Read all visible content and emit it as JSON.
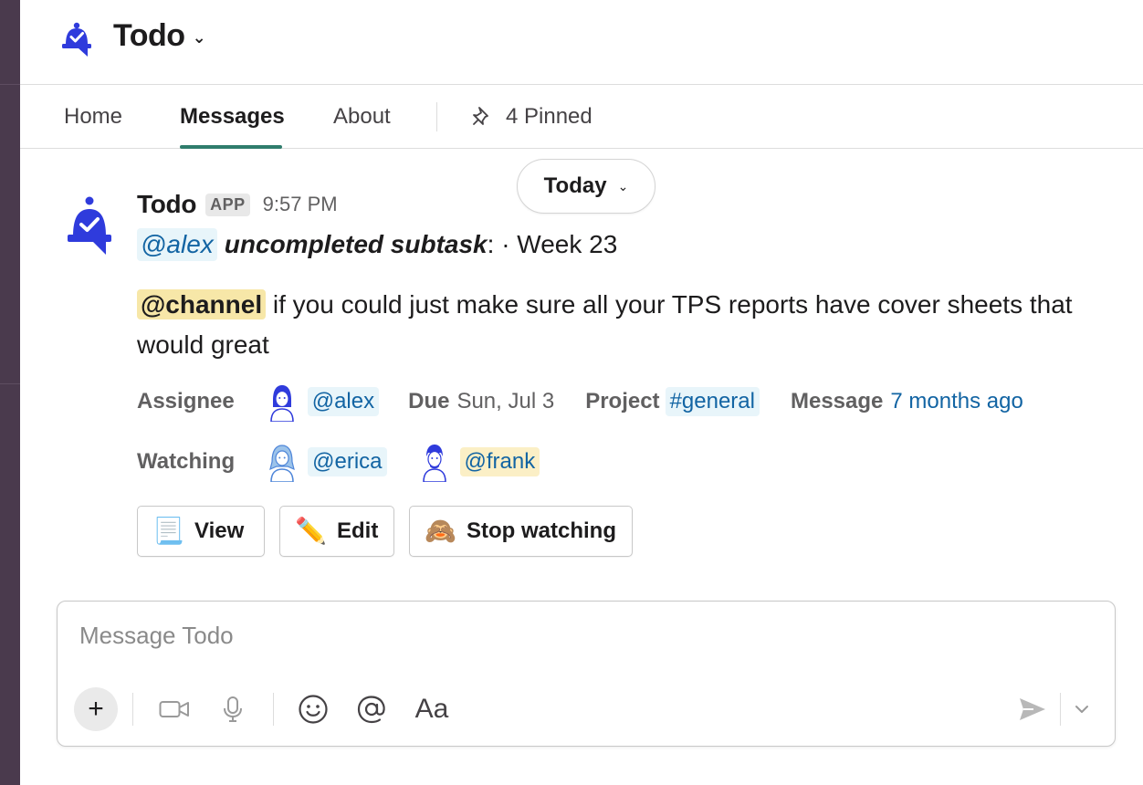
{
  "app": {
    "title": "Todo",
    "accent_color": "#2f3bdc",
    "tab_underline_color": "#2f7d6c"
  },
  "tabs": [
    {
      "label": "Home",
      "active": false
    },
    {
      "label": "Messages",
      "active": true
    },
    {
      "label": "About",
      "active": false
    }
  ],
  "pinned": {
    "label": "4 Pinned",
    "icon": "pin-icon"
  },
  "date_divider": {
    "label": "Today"
  },
  "message": {
    "sender": "Todo",
    "badge": "APP",
    "time": "9:57 PM",
    "line1": {
      "mention": "@alex",
      "subtitle": "uncompleted subtask",
      "suffix": ": · Week 23"
    },
    "body": {
      "channel_mention": "@channel",
      "text": " if you could just make sure all your TPS reports have cover sheets that would great"
    },
    "fields": {
      "assignee_label": "Assignee",
      "assignee": "@alex",
      "due_label": "Due",
      "due_value": "Sun, Jul 3",
      "project_label": "Project",
      "project": "#general",
      "message_label": "Message",
      "message_value": "7 months ago",
      "watching_label": "Watching",
      "watchers": [
        "@erica",
        "@frank"
      ]
    },
    "actions": [
      {
        "label": "View",
        "emoji": "scroll-icon"
      },
      {
        "label": "Edit",
        "emoji": "pencil-icon"
      },
      {
        "label": "Stop watching",
        "emoji": "see-no-evil-monkey-icon"
      }
    ]
  },
  "composer": {
    "placeholder": "Message Todo",
    "value": "",
    "font_button": "Aa"
  }
}
